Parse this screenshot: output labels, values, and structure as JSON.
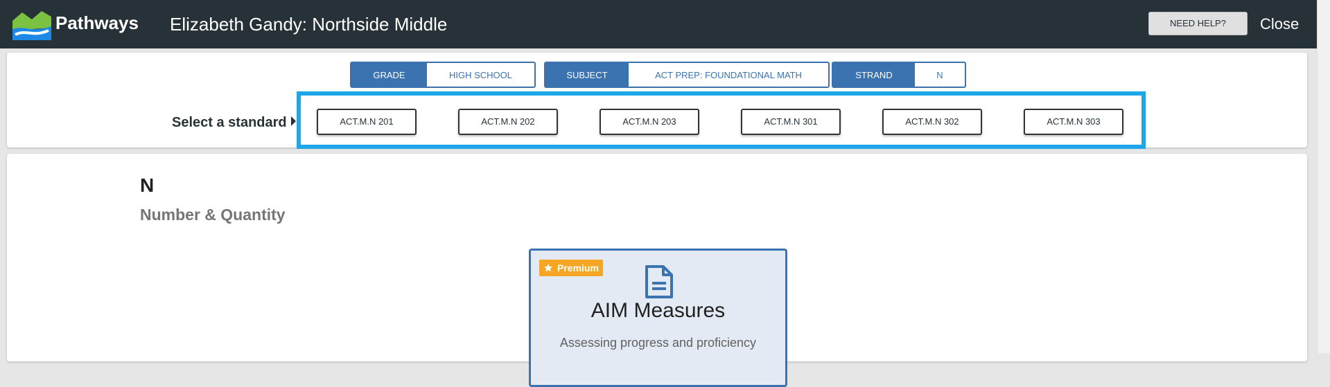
{
  "header": {
    "brand": "Pathways",
    "title": "Elizabeth Gandy: Northside Middle",
    "help_label": "NEED HELP?",
    "close_label": "Close"
  },
  "filters": [
    {
      "key": "GRADE",
      "value": "HIGH SCHOOL"
    },
    {
      "key": "SUBJECT",
      "value": "ACT PREP: FOUNDATIONAL MATH"
    },
    {
      "key": "STRAND",
      "value": "N"
    }
  ],
  "standards": {
    "label": "Select a standard",
    "items": [
      "ACT.M.N 201",
      "ACT.M.N 202",
      "ACT.M.N 203",
      "ACT.M.N 301",
      "ACT.M.N 302",
      "ACT.M.N 303"
    ]
  },
  "strand": {
    "code": "N",
    "name": "Number & Quantity"
  },
  "card": {
    "badge": "Premium",
    "title": "AIM Measures",
    "subtitle": "Assessing progress and proficiency"
  },
  "colors": {
    "header_bg": "#263238",
    "accent_blue": "#3b73b0",
    "highlight": "#1ea7e8",
    "premium": "#f5a623"
  }
}
